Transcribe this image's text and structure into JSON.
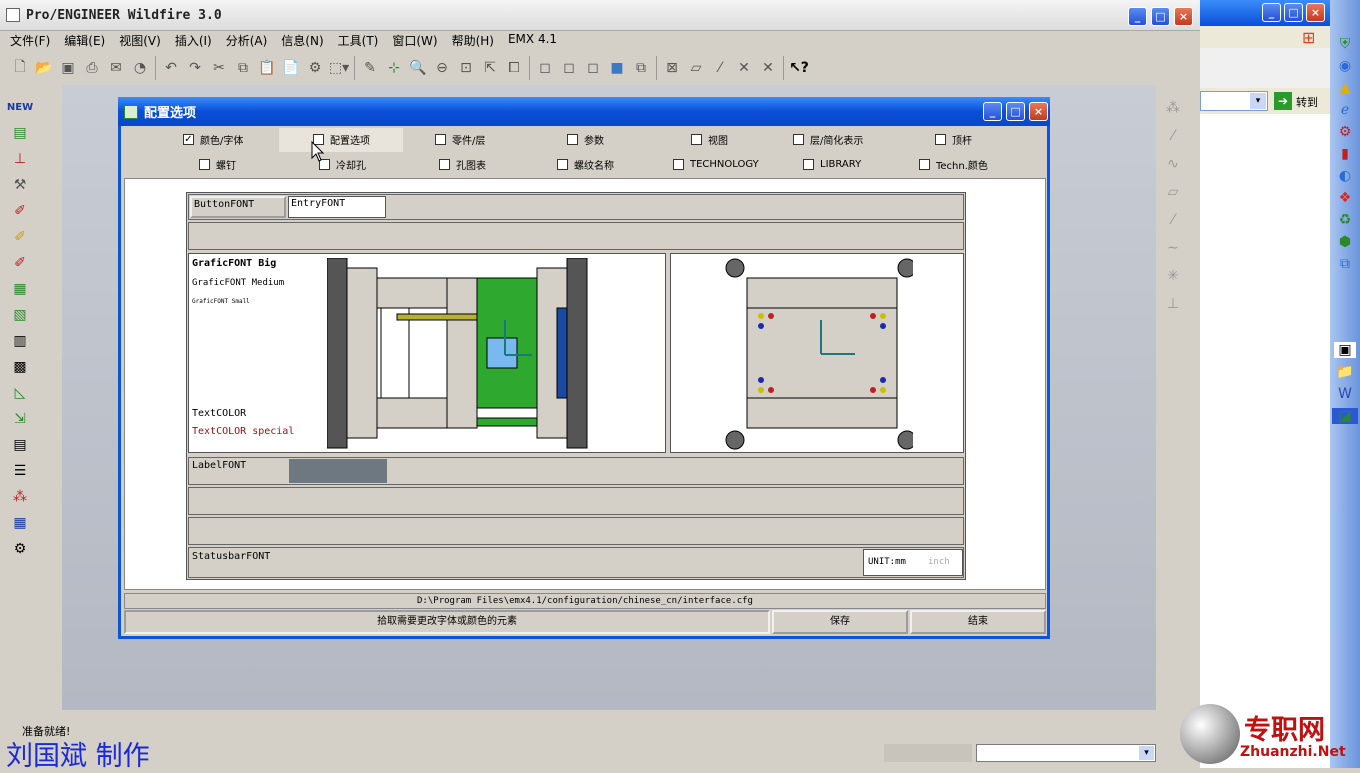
{
  "app": {
    "title": "Pro/ENGINEER Wildfire 3.0"
  },
  "menu": [
    "文件(F)",
    "编辑(E)",
    "视图(V)",
    "插入(I)",
    "分析(A)",
    "信息(N)",
    "工具(T)",
    "窗口(W)",
    "帮助(H)",
    "EMX 4.1"
  ],
  "dialog": {
    "title": "配置选项",
    "checkboxes_row1": [
      {
        "label": "颜色/字体",
        "checked": true
      },
      {
        "label": "配置选项",
        "checked": false
      },
      {
        "label": "零件/层",
        "checked": false
      },
      {
        "label": "参数",
        "checked": false
      },
      {
        "label": "视图",
        "checked": false
      },
      {
        "label": "层/简化表示",
        "checked": false
      },
      {
        "label": "顶杆",
        "checked": false
      }
    ],
    "checkboxes_row2": [
      {
        "label": "螺钉",
        "checked": false
      },
      {
        "label": "冷却孔",
        "checked": false
      },
      {
        "label": "孔图表",
        "checked": false
      },
      {
        "label": "螺纹名称",
        "checked": false
      },
      {
        "label": "TECHNOLOGY",
        "checked": false
      },
      {
        "label": "LIBRARY",
        "checked": false
      },
      {
        "label": "Techn.颜色",
        "checked": false
      }
    ],
    "button_font": "ButtonFONT",
    "entry_font": "EntryFONT",
    "grafic_big": "GraficFONT Big",
    "grafic_medium": "GraficFONT Medium",
    "grafic_small": "GraficFONT Small",
    "text_color": "TextCOLOR",
    "text_color_special": "TextCOLOR special",
    "label_font": "LabelFONT",
    "statusbar_font": "StatusbarFONT",
    "unit_mm": "UNIT:mm",
    "unit_inch": "inch",
    "path": "D:\\Program Files\\emx4.1/configuration/chinese_cn/interface.cfg",
    "hint": "拾取需要更改字体或颜色的元素",
    "save": "保存",
    "end": "结束"
  },
  "status": {
    "ready": "准备就绪!"
  },
  "watermark": {
    "author": "刘国斌 制作",
    "site_cn": "专职网",
    "site_en": "Zhuanzhi.Net"
  },
  "side_browser": {
    "goto": "转到"
  },
  "colors": {
    "title_blue": "#0a54e0",
    "mold_green": "#2fa82f",
    "mold_blue": "#1a4aa0",
    "plate_dark": "#555555"
  }
}
